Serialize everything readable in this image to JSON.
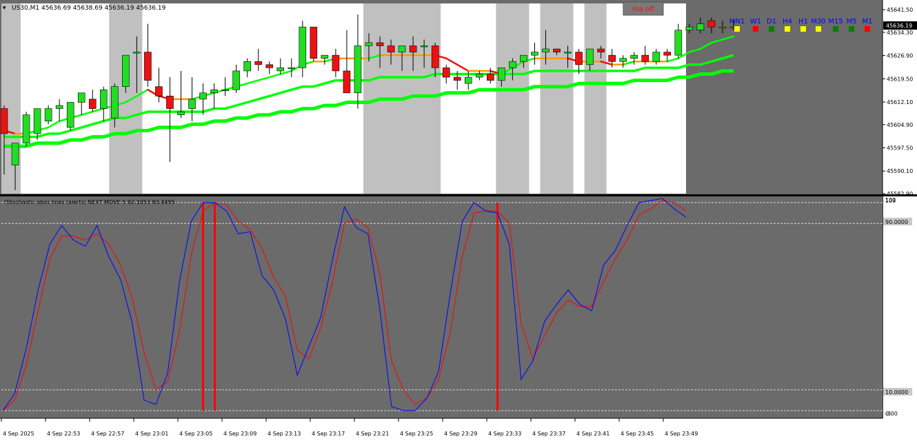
{
  "symbol_header": "US30,M1  45636.69 45638.69 45636.19 45636.19",
  "ma_button": "ma off",
  "timeframes": [
    {
      "label": "MN1",
      "status_color": "#ffff00"
    },
    {
      "label": "W1",
      "status_color": "#ff0000"
    },
    {
      "label": "D1",
      "status_color": "#008000"
    },
    {
      "label": "H4",
      "status_color": "#ffff00"
    },
    {
      "label": "H1",
      "status_color": "#ffff00"
    },
    {
      "label": "M30",
      "status_color": "#ffff00"
    },
    {
      "label": "M15",
      "status_color": "#008000"
    },
    {
      "label": "M5",
      "status_color": "#008000"
    },
    {
      "label": "M1",
      "status_color": "#ff0000"
    }
  ],
  "price_axis_ticks": [
    "45641.50",
    "45634.30",
    "45626.90",
    "45619.50",
    "45612.10",
    "45604.90",
    "45597.50",
    "45590.10",
    "45582.90"
  ],
  "current_price": "45636.19",
  "indicator_title": "!Stochastic obos lines (alerts) NEXT MOVE 5 92.1053 93.4495",
  "indicator_axis": {
    "top_a": "100",
    "top_b": "103",
    "level_high": "90.0000",
    "level_low": "10.0000",
    "bottom_a": "0.00",
    "bottom_b": "-3"
  },
  "time_labels": [
    "4 Sep 2025",
    "4 Sep 22:53",
    "4 Sep 22:57",
    "4 Sep 23:01",
    "4 Sep 23:05",
    "4 Sep 23:09",
    "4 Sep 23:13",
    "4 Sep 23:17",
    "4 Sep 23:21",
    "4 Sep 23:25",
    "4 Sep 23:29",
    "4 Sep 23:33",
    "4 Sep 23:37",
    "4 Sep 23:41",
    "4 Sep 23:45",
    "4 Sep 23:49"
  ],
  "colors": {
    "bull": "#22dd22",
    "bear": "#ee1111",
    "stoch_main": "#0000ff",
    "stoch_signal": "#ff0000",
    "ma_green": "#00ff00",
    "highlight": "#c0c0c0"
  },
  "chart_data": {
    "type": "candlestick",
    "candles": [
      [
        45610,
        45611,
        45589,
        45602
      ],
      [
        45592,
        45599,
        45584,
        45599
      ],
      [
        45599,
        45609,
        45598,
        45608
      ],
      [
        45602,
        45610,
        45600,
        45610
      ],
      [
        45606,
        45611,
        45605,
        45610
      ],
      [
        45610,
        45613,
        45606,
        45611
      ],
      [
        45604,
        45612,
        45603,
        45612
      ],
      [
        45612,
        45615,
        45608,
        45615
      ],
      [
        45613,
        45616,
        45609,
        45610
      ],
      [
        45610,
        45617,
        45606,
        45616
      ],
      [
        45607,
        45618,
        45604,
        45617
      ],
      [
        45617,
        45622,
        45615,
        45627
      ],
      [
        45628,
        45633,
        45615,
        45628
      ],
      [
        45628,
        45637,
        45617,
        45619
      ],
      [
        45617,
        45623,
        45612,
        45614
      ],
      [
        45614,
        45620,
        45593,
        45610
      ],
      [
        45608,
        45622,
        45607,
        45609
      ],
      [
        45610,
        45620,
        45606,
        45613
      ],
      [
        45613,
        45618,
        45608,
        45615
      ],
      [
        45615,
        45618,
        45610,
        45616
      ],
      [
        45616,
        45620,
        45614,
        45616
      ],
      [
        45616,
        45624,
        45615,
        45622
      ],
      [
        45622,
        45626,
        45620,
        45625
      ],
      [
        45625,
        45629,
        45622,
        45624
      ],
      [
        45624,
        45625,
        45621,
        45623
      ],
      [
        45622,
        45626,
        45621,
        45623
      ],
      [
        45623,
        45626,
        45620,
        45623
      ],
      [
        45623,
        45638,
        45620,
        45636
      ],
      [
        45636,
        45636,
        45625,
        45626
      ],
      [
        45626,
        45627,
        45624,
        45627
      ],
      [
        45627,
        45629,
        45620,
        45622
      ],
      [
        45622,
        45635,
        45616,
        45615
      ],
      [
        45615,
        45640,
        45610,
        45630
      ],
      [
        45630,
        45634,
        45625,
        45631
      ],
      [
        45631,
        45633,
        45623,
        45630
      ],
      [
        45630,
        45632,
        45624,
        45628
      ],
      [
        45628,
        45629,
        45622,
        45630
      ],
      [
        45630,
        45633,
        45622,
        45628
      ],
      [
        45630,
        45632,
        45623,
        45630
      ],
      [
        45630,
        45631,
        45620,
        45623
      ],
      [
        45623,
        45624,
        45618,
        45620
      ],
      [
        45620,
        45622,
        45616,
        45619
      ],
      [
        45618,
        45622,
        45616,
        45620
      ],
      [
        45620,
        45622,
        45619,
        45621
      ],
      [
        45621,
        45623,
        45618,
        45619
      ],
      [
        45619,
        45622,
        45617,
        45623
      ],
      [
        45623,
        45626,
        45619,
        45625
      ],
      [
        45625,
        45627,
        45623,
        45627
      ],
      [
        45627,
        45631,
        45624,
        45628
      ],
      [
        45628,
        45635,
        45624,
        45629
      ],
      [
        45629,
        45628,
        45627,
        45628
      ],
      [
        45628,
        45630,
        45623,
        45628
      ],
      [
        45628,
        45629,
        45621,
        45624
      ],
      [
        45624,
        45627,
        45622,
        45629
      ],
      [
        45629,
        45630,
        45626,
        45628
      ],
      [
        45627,
        45629,
        45623,
        45625
      ],
      [
        45625,
        45627,
        45623,
        45626
      ],
      [
        45626,
        45628,
        45624,
        45627
      ],
      [
        45627,
        45630,
        45624,
        45625
      ],
      [
        45625,
        45629,
        45624,
        45628
      ],
      [
        45628,
        45629,
        45625,
        45627
      ],
      [
        45627,
        45637,
        45626,
        45635
      ],
      [
        45635,
        45637,
        45634,
        45636
      ],
      [
        45635,
        45639,
        45634,
        45637
      ],
      [
        45638,
        45639,
        45634,
        45636
      ],
      [
        45636,
        45638,
        45634,
        45636
      ],
      [
        45636,
        45638,
        45635,
        45636
      ]
    ],
    "ma_fast": [
      45603,
      45602,
      45602,
      45603,
      45604,
      45606,
      45607,
      45608,
      45609,
      45610,
      45611,
      45612,
      45614,
      45616,
      45614,
      45613,
      45613,
      45613,
      45614,
      45615,
      45616,
      45617,
      45618,
      45619,
      45620,
      45621,
      45622,
      45624,
      45625,
      45625,
      45626,
      45626,
      45626,
      45626,
      45627,
      45627,
      45627,
      45627,
      45627,
      45627,
      45626,
      45624,
      45622,
      45622,
      45622,
      45621,
      45623,
      45625,
      45626,
      45626,
      45626,
      45626,
      45625,
      45625,
      45625,
      45624,
      45624,
      45625,
      45625,
      45625,
      45625,
      45626,
      45628,
      45629,
      45631,
      45632,
      45633
    ],
    "ma_mid": [
      45601,
      45601,
      45601,
      45601,
      45602,
      45602,
      45603,
      45604,
      45605,
      45606,
      45607,
      45607,
      45608,
      45609,
      45609,
      45609,
      45609,
      45609,
      45609,
      45610,
      45610,
      45611,
      45612,
      45613,
      45614,
      45615,
      45616,
      45617,
      45617,
      45618,
      45619,
      45619,
      45619,
      45619,
      45620,
      45620,
      45620,
      45620,
      45620,
      45621,
      45621,
      45621,
      45621,
      45621,
      45621,
      45621,
      45621,
      45621,
      45622,
      45622,
      45622,
      45622,
      45622,
      45622,
      45622,
      45622,
      45622,
      45622,
      45623,
      45623,
      45623,
      45623,
      45624,
      45624,
      45625,
      45626,
      45627
    ],
    "ma_slow": [
      45598,
      45598,
      45598,
      45599,
      45599,
      45599,
      45600,
      45600,
      45601,
      45601,
      45602,
      45602,
      45603,
      45603,
      45604,
      45604,
      45604,
      45605,
      45605,
      45606,
      45606,
      45607,
      45607,
      45608,
      45608,
      45609,
      45609,
      45610,
      45610,
      45611,
      45611,
      45612,
      45612,
      45612,
      45613,
      45613,
      45613,
      45614,
      45614,
      45614,
      45615,
      45615,
      45615,
      45616,
      45616,
      45616,
      45616,
      45616,
      45617,
      45617,
      45617,
      45617,
      45618,
      45618,
      45618,
      45618,
      45618,
      45619,
      45619,
      45619,
      45619,
      45620,
      45620,
      45621,
      45621,
      45622,
      45622
    ],
    "stoch_main": [
      0,
      8,
      30,
      58,
      80,
      89,
      82,
      79,
      89,
      74,
      63,
      42,
      5,
      3,
      18,
      62,
      91,
      100,
      100,
      96,
      85,
      86,
      65,
      58,
      44,
      17,
      31,
      45,
      73,
      98,
      88,
      85,
      49,
      2,
      0,
      0,
      6,
      19,
      57,
      91,
      100,
      96,
      95,
      80,
      15,
      24,
      43,
      51,
      58,
      51,
      48,
      70,
      77,
      89,
      100,
      101,
      102,
      97,
      93
    ],
    "stoch_main_tail": [],
    "stoch_signal": [
      0,
      5,
      22,
      48,
      73,
      84,
      84,
      82,
      85,
      80,
      70,
      54,
      28,
      10,
      14,
      38,
      75,
      96,
      100,
      99,
      91,
      87,
      78,
      64,
      55,
      29,
      25,
      40,
      62,
      90,
      92,
      88,
      66,
      24,
      10,
      3,
      6,
      15,
      38,
      74,
      95,
      96,
      96,
      90,
      42,
      25,
      36,
      47,
      53,
      50,
      50,
      62,
      73,
      82,
      94,
      97,
      101,
      100,
      96
    ],
    "stoch_levels": [
      90,
      10
    ],
    "signal_lines": [
      17,
      18,
      42
    ],
    "highlight_spans": [
      [
        0,
        1
      ],
      [
        10,
        12
      ],
      [
        33,
        39
      ],
      [
        45,
        47
      ],
      [
        49,
        51
      ],
      [
        53,
        54
      ]
    ],
    "price_ylim": [
      45582.9,
      45643.5
    ],
    "stoch_ylim": [
      -3,
      103
    ]
  }
}
